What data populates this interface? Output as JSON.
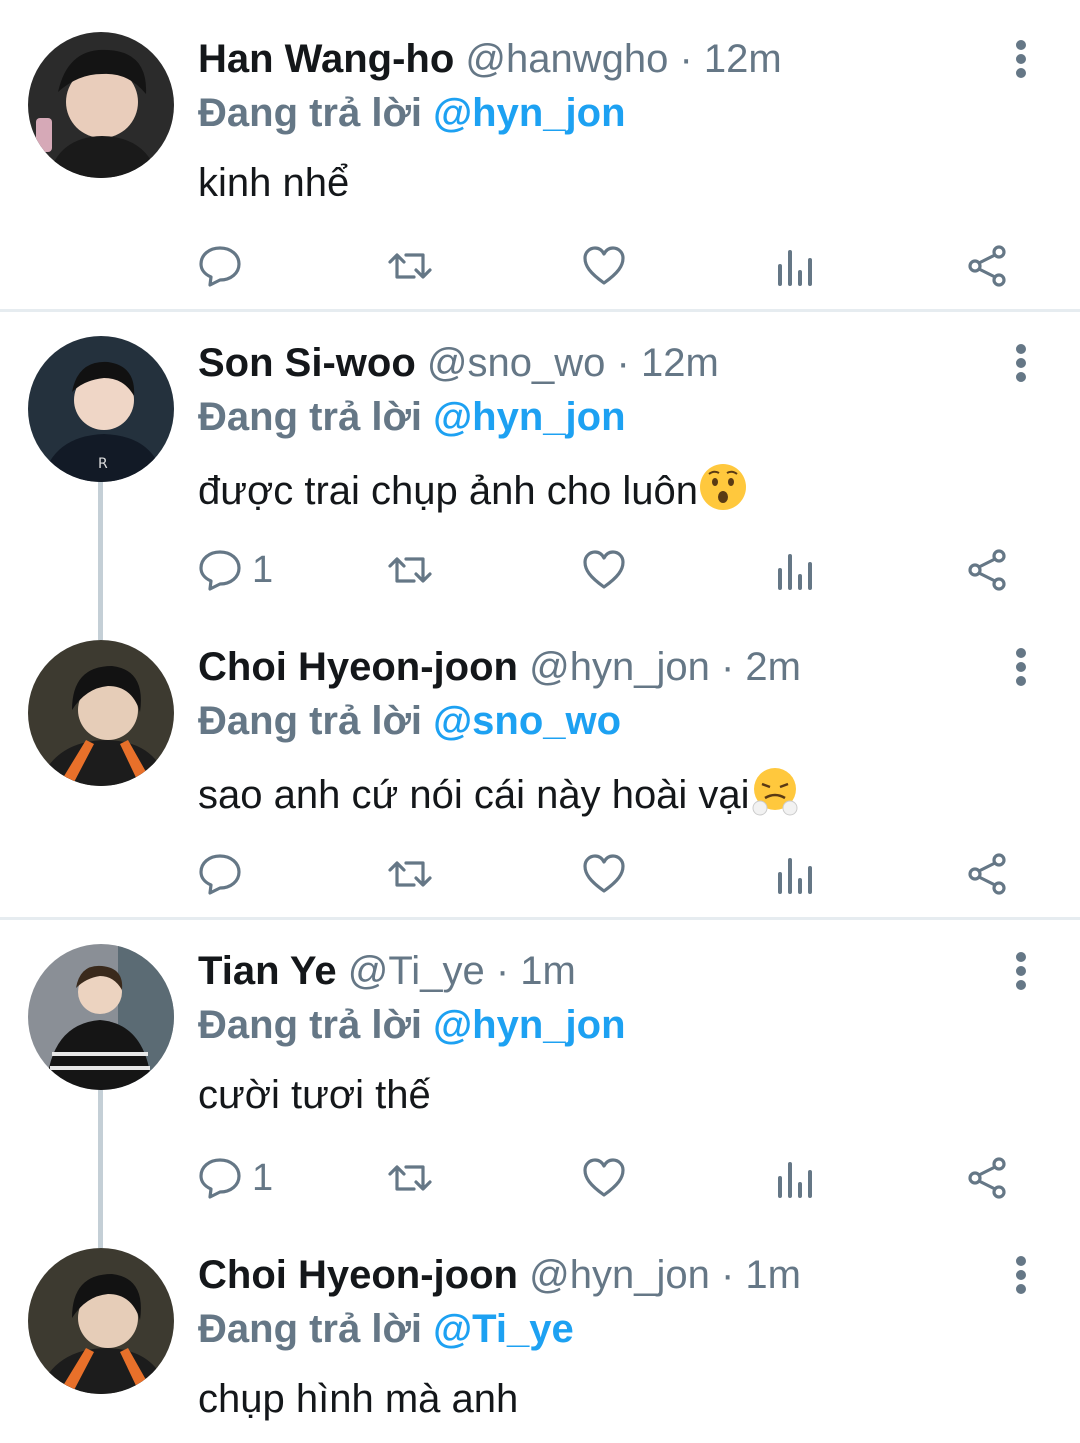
{
  "tweets": [
    {
      "name": "Han Wang-ho",
      "handle": "@hanwgho",
      "sep": "·",
      "time": "12m",
      "reply_prefix": "Đang trả lời",
      "reply_to": "@hyn_jon",
      "text": "kinh nhể",
      "reply_count": ""
    },
    {
      "name": "Son Si-woo",
      "handle": "@sno_wo",
      "sep": "·",
      "time": "12m",
      "reply_prefix": "Đang trả lời",
      "reply_to": "@hyn_jon",
      "text": "được trai chụp ảnh cho luôn",
      "emoji": "hushed-face",
      "reply_count": "1"
    },
    {
      "name": "Choi Hyeon-joon",
      "handle": "@hyn_jon",
      "sep": "·",
      "time": "2m",
      "reply_prefix": "Đang trả lời",
      "reply_to": "@sno_wo",
      "text": "sao anh cứ nói cái này hoài vại",
      "emoji": "steam-nose-face",
      "reply_count": ""
    },
    {
      "name": "Tian Ye",
      "handle": "@Ti_ye",
      "sep": "·",
      "time": "1m",
      "reply_prefix": "Đang trả lời",
      "reply_to": "@hyn_jon",
      "text": "cười tươi thế",
      "reply_count": "1"
    },
    {
      "name": "Choi Hyeon-joon",
      "handle": "@hyn_jon",
      "sep": "·",
      "time": "1m",
      "reply_prefix": "Đang trả lời",
      "reply_to": "@Ti_ye",
      "text": "chụp hình mà anh",
      "reply_count": ""
    }
  ],
  "icons": {
    "reply": "reply-icon",
    "retweet": "retweet-icon",
    "like": "heart-icon",
    "stats": "analytics-icon",
    "share": "share-icon",
    "more": "more-vertical-icon"
  },
  "colors": {
    "accent": "#1da1f2",
    "muted": "#657786",
    "text": "#14171a",
    "divider": "#e6ecf0"
  }
}
